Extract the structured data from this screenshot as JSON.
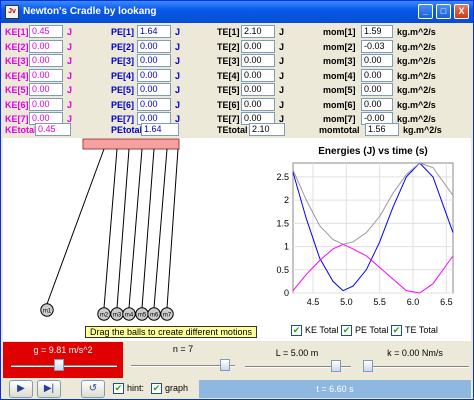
{
  "window": {
    "title": "Newton's Cradle by lookang",
    "icon": "java-icon",
    "buttons": [
      "_",
      "□",
      "X"
    ]
  },
  "table": {
    "rows": [
      {
        "ke_label": "KE[1]",
        "ke": "0.45",
        "pe_label": "PE[1]",
        "pe": "1.64",
        "te_label": "TE[1]",
        "te": "2.10",
        "mom_label": "mom[1]",
        "mom": "1.59"
      },
      {
        "ke_label": "KE[2]",
        "ke": "0.00",
        "pe_label": "PE[2]",
        "pe": "0.00",
        "te_label": "TE[2]",
        "te": "0.00",
        "mom_label": "mom[2]",
        "mom": "-0.03"
      },
      {
        "ke_label": "KE[3]",
        "ke": "0.00",
        "pe_label": "PE[3]",
        "pe": "0.00",
        "te_label": "TE[3]",
        "te": "0.00",
        "mom_label": "mom[3]",
        "mom": "0.00"
      },
      {
        "ke_label": "KE[4]",
        "ke": "0.00",
        "pe_label": "PE[4]",
        "pe": "0.00",
        "te_label": "TE[4]",
        "te": "0.00",
        "mom_label": "mom[4]",
        "mom": "0.00"
      },
      {
        "ke_label": "KE[5]",
        "ke": "0.00",
        "pe_label": "PE[5]",
        "pe": "0.00",
        "te_label": "TE[5]",
        "te": "0.00",
        "mom_label": "mom[5]",
        "mom": "0.00"
      },
      {
        "ke_label": "KE[6]",
        "ke": "0.00",
        "pe_label": "PE[6]",
        "pe": "0.00",
        "te_label": "TE[6]",
        "te": "0.00",
        "mom_label": "mom[6]",
        "mom": "0.00"
      },
      {
        "ke_label": "KE[7]",
        "ke": "0.00",
        "pe_label": "PE[7]",
        "pe": "0.00",
        "te_label": "TE[7]",
        "te": "0.00",
        "mom_label": "mom[7]",
        "mom": "-0.00"
      }
    ],
    "unit_j": "J",
    "unit_mom": "kg.m^2/s",
    "totals": {
      "ke_label": "KEtotal",
      "ke": "0.45",
      "pe_label": "PEtotal",
      "pe": "1.64",
      "te_label": "TEtotal",
      "te": "2.10",
      "mom_label": "momtotal",
      "mom": "1.56",
      "mom_unit": "kg.m^2/s"
    }
  },
  "balls": [
    "m1",
    "m2",
    "m3",
    "m4",
    "m5",
    "m6",
    "m7"
  ],
  "hint_text": "Drag the balls to create different motions",
  "chart_data": {
    "type": "line",
    "title": "Energies (J) vs time (s)",
    "xlim": [
      4.2,
      6.6
    ],
    "ylim": [
      0,
      2.8
    ],
    "x_ticks": [
      "4.5",
      "5.0",
      "5.5",
      "6.0",
      "6.5"
    ],
    "y_ticks": [
      "0",
      "0.5",
      "1",
      "1.5",
      "2",
      "2.5"
    ],
    "grid": true,
    "series": [
      {
        "name": "KE Total",
        "color": "#0000ff",
        "x": [
          4.2,
          4.4,
          4.6,
          4.8,
          4.95,
          5.1,
          5.3,
          5.5,
          5.7,
          5.9,
          6.1,
          6.3,
          6.5,
          6.6
        ],
        "y": [
          2.6,
          1.6,
          0.75,
          0.25,
          0.05,
          0.15,
          0.5,
          1.1,
          1.85,
          2.5,
          2.8,
          2.5,
          1.7,
          1.3
        ]
      },
      {
        "name": "PE Total",
        "color": "#ff00ff",
        "x": [
          4.2,
          4.4,
          4.6,
          4.8,
          4.95,
          5.1,
          5.3,
          5.5,
          5.7,
          5.9,
          6.1,
          6.3,
          6.5,
          6.6
        ],
        "y": [
          0.05,
          0.4,
          0.7,
          0.95,
          1.05,
          0.95,
          0.8,
          0.55,
          0.3,
          0.05,
          0.0,
          0.2,
          0.6,
          0.8
        ]
      },
      {
        "name": "TE Total",
        "color": "#999999",
        "x": [
          4.2,
          4.4,
          4.6,
          4.8,
          4.95,
          5.1,
          5.3,
          5.5,
          5.7,
          5.9,
          6.1,
          6.3,
          6.5,
          6.6
        ],
        "y": [
          2.65,
          2.0,
          1.45,
          1.15,
          1.05,
          1.1,
          1.3,
          1.65,
          2.15,
          2.55,
          2.8,
          2.7,
          2.3,
          2.1
        ]
      }
    ]
  },
  "checkboxes": [
    {
      "label": "KE Total",
      "checked": true
    },
    {
      "label": "PE Total",
      "checked": true
    },
    {
      "label": "TE Total",
      "checked": true
    }
  ],
  "sliders": {
    "g": {
      "label": "g = 9.81 m/s^2",
      "fraction": 0.45
    },
    "n": {
      "label": "n = 7",
      "fraction": 0.95
    },
    "L": {
      "label": "L = 5.00 m",
      "fraction": 0.9
    },
    "k": {
      "label": "k = 0.00 Nm/s",
      "fraction": 0.0
    }
  },
  "toolbar": {
    "play": "▶",
    "step": "▶|",
    "reset": "↺",
    "hint_label": "hint:",
    "graph_label": "graph",
    "time": "t = 6.60 s"
  }
}
